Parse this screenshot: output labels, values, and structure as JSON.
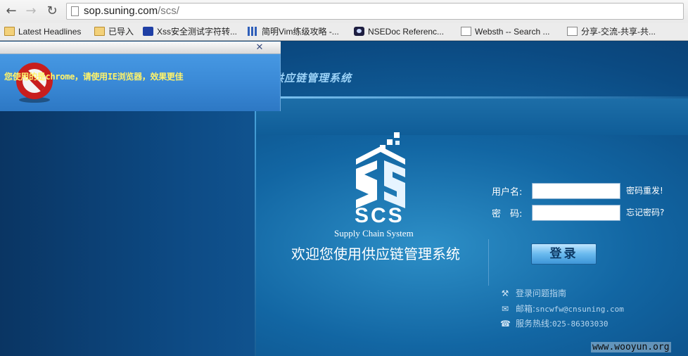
{
  "browser": {
    "url_host": "sop.suning.com",
    "url_path": "/scs/",
    "bookmarks": [
      {
        "label": "Latest Headlines",
        "icon": "folder-icon"
      },
      {
        "label": "已导入",
        "icon": "folder-icon"
      },
      {
        "label": "Xss安全测试字符转...",
        "icon": "paw-icon"
      },
      {
        "label": "简明Vim练级攻略 -...",
        "icon": "bars-icon"
      },
      {
        "label": "NSEDoc Referenc...",
        "icon": "eye-icon"
      },
      {
        "label": "Websth -- Search ...",
        "icon": "page-icon"
      },
      {
        "label": "分享-交流-共享-共...",
        "icon": "page-icon"
      }
    ]
  },
  "popup": {
    "message": "您使用的是chrome，请使用IE浏览器，效果更佳",
    "close_glyph": "✕"
  },
  "header": {
    "system_title": "供应链管理系统"
  },
  "logo": {
    "text": "SCS",
    "subtitle": "Supply Chain System",
    "welcome": "欢迎您使用供应链管理系统"
  },
  "login": {
    "username_label": "用户名:",
    "password_label": "密　码:",
    "username_value": "",
    "password_value": "",
    "reset_password_link": "密码重发!",
    "forgot_password_link": "忘记密码?",
    "submit_label": "登录"
  },
  "info": {
    "guide": "登录问题指南",
    "email_label": "邮箱:",
    "email": "sncwfw@cnsuning.com",
    "hotline_label": "服务热线:",
    "hotline": "025-86303030"
  },
  "watermark": "www.wooyun.org",
  "colors": {
    "page_bg": "#0b4a82",
    "popup_bg": "#3a89d6",
    "popup_text": "#fff36a",
    "login_button": "#69b9ee"
  }
}
